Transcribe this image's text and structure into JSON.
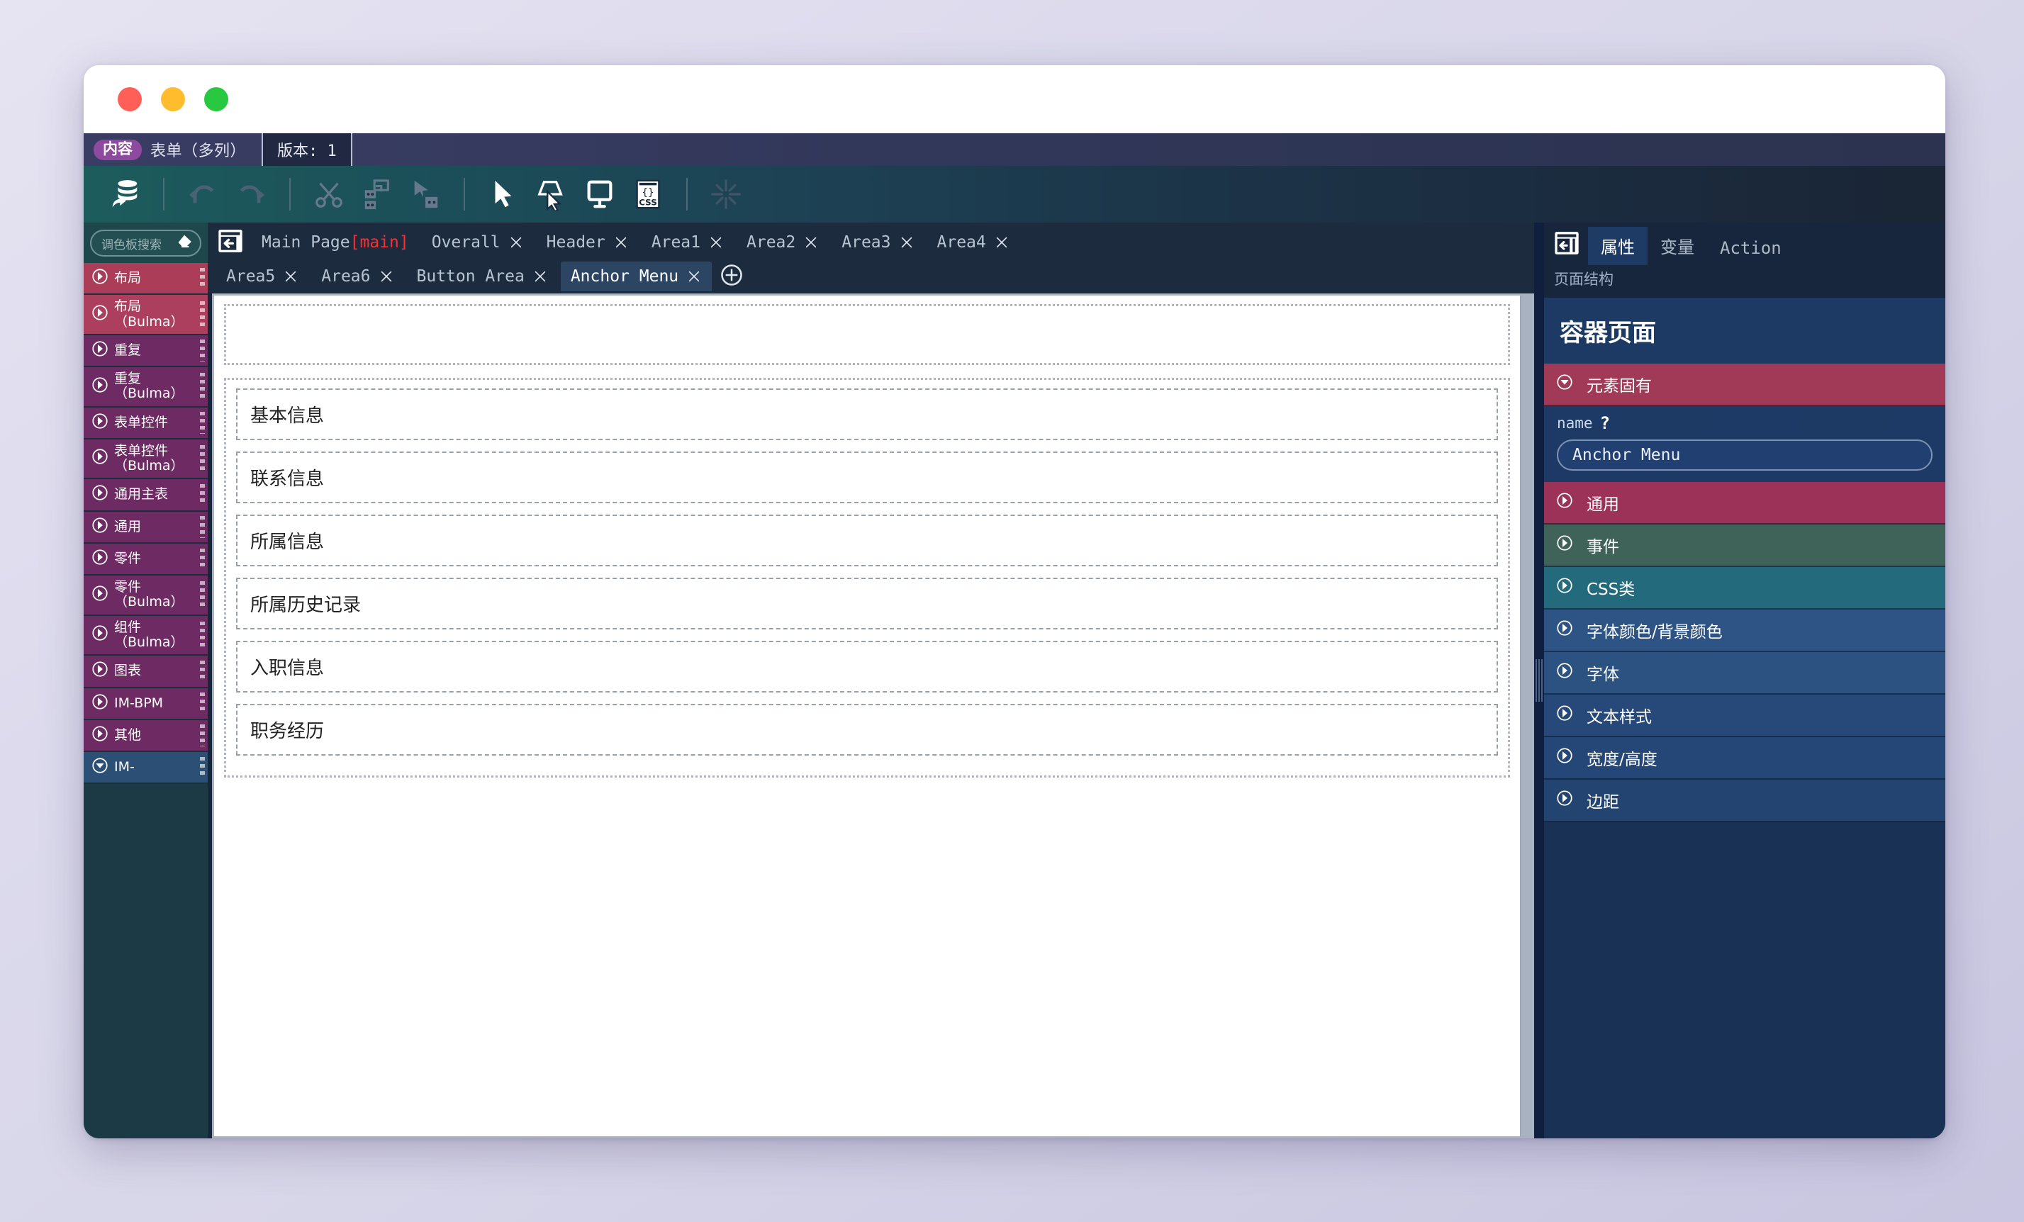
{
  "header": {
    "badge": "内容",
    "title": "表单（多列）",
    "version": "版本: 1"
  },
  "toolbar": {
    "items": [
      {
        "name": "save-to-database-button",
        "icon": "database-export-icon"
      },
      {
        "name": "undo-button",
        "icon": "undo-arrow-icon"
      },
      {
        "name": "redo-button",
        "icon": "redo-arrow-icon"
      },
      {
        "name": "cut-button",
        "icon": "scissors-icon"
      },
      {
        "name": "copy-button",
        "icon": "copy-blocks-icon"
      },
      {
        "name": "paste-button",
        "icon": "paste-arrow-icon"
      },
      {
        "name": "select-tool-button",
        "icon": "cursor-arrow-icon"
      },
      {
        "name": "pick-element-button",
        "icon": "cursor-select-shape-icon"
      },
      {
        "name": "preview-button",
        "icon": "monitor-icon"
      },
      {
        "name": "css-editor-button",
        "icon": "css-braces-icon"
      },
      {
        "name": "reset-layout-button",
        "icon": "asterisk-burst-icon"
      }
    ]
  },
  "palette": {
    "search_placeholder": "调色板搜索",
    "clear_icon": "eraser-icon",
    "items": [
      {
        "label": "布局",
        "color": "#ac3d58",
        "state": "collapsed"
      },
      {
        "label": "布局（Bulma）",
        "color": "#ab3f5d",
        "state": "collapsed"
      },
      {
        "label": "重复",
        "color": "#6e2a63",
        "state": "collapsed"
      },
      {
        "label": "重复（Bulma）",
        "color": "#6e2a63",
        "state": "collapsed"
      },
      {
        "label": "表单控件",
        "color": "#6e2a63",
        "state": "collapsed"
      },
      {
        "label": "表单控件\n（Bulma）",
        "color": "#6e2a63",
        "state": "collapsed"
      },
      {
        "label": "通用主表",
        "color": "#6e2a63",
        "state": "collapsed"
      },
      {
        "label": "通用",
        "color": "#6e2a63",
        "state": "collapsed"
      },
      {
        "label": "零件",
        "color": "#6e2a63",
        "state": "collapsed"
      },
      {
        "label": "零件（Bulma）",
        "color": "#6e2a63",
        "state": "collapsed"
      },
      {
        "label": "组件（Bulma）",
        "color": "#6e2a63",
        "state": "collapsed"
      },
      {
        "label": "图表",
        "color": "#6e2a63",
        "state": "collapsed"
      },
      {
        "label": "IM-BPM",
        "color": "#6e2a63",
        "state": "collapsed"
      },
      {
        "label": "其他",
        "color": "#6e2a63",
        "state": "collapsed"
      },
      {
        "label": "IM-",
        "color": "#2c4f75",
        "state": "expanded"
      }
    ]
  },
  "tabs": {
    "back_icon": "panel-collapse-left-icon",
    "add_icon": "add-tab-icon",
    "row1": [
      {
        "label": "Main Page",
        "suffix": "[main]",
        "closable": false,
        "active": false
      },
      {
        "label": "Overall",
        "closable": true,
        "active": false
      },
      {
        "label": "Header",
        "closable": true,
        "active": false
      },
      {
        "label": "Area1",
        "closable": true,
        "active": false
      },
      {
        "label": "Area2",
        "closable": true,
        "active": false
      },
      {
        "label": "Area3",
        "closable": true,
        "active": false
      },
      {
        "label": "Area4",
        "closable": true,
        "active": false
      }
    ],
    "row2": [
      {
        "label": "Area5",
        "closable": true,
        "active": false
      },
      {
        "label": "Area6",
        "closable": true,
        "active": false
      },
      {
        "label": "Button Area",
        "closable": true,
        "active": false
      },
      {
        "label": "Anchor Menu",
        "closable": true,
        "active": true
      }
    ]
  },
  "canvas": {
    "sections": [
      {
        "label": "基本信息"
      },
      {
        "label": "联系信息"
      },
      {
        "label": "所属信息"
      },
      {
        "label": "所属历史记录"
      },
      {
        "label": "入职信息"
      },
      {
        "label": "职务经历"
      }
    ]
  },
  "inspector": {
    "panel_icon": "panel-collapse-left-icon",
    "tabs": [
      {
        "label": "属性",
        "active": true
      },
      {
        "label": "变量",
        "active": false
      },
      {
        "label": "Action",
        "active": false,
        "mono": true
      }
    ],
    "subtabs": [
      {
        "label": "页面结构",
        "active": true
      }
    ],
    "title": "容器页面",
    "intrinsic_section": {
      "label": "元素固有",
      "color": "#a03a56",
      "state": "expanded"
    },
    "name_field": {
      "label": "name",
      "help": "?",
      "value": "Anchor Menu"
    },
    "sections": [
      {
        "label": "通用",
        "color": "#9c3257",
        "state": "collapsed"
      },
      {
        "label": "事件",
        "color": "#3f6358",
        "state": "collapsed"
      },
      {
        "label": "CSS类",
        "color": "#236a7c",
        "state": "collapsed"
      },
      {
        "label": "字体颜色/背景颜色",
        "color": "#2d5485",
        "state": "collapsed"
      },
      {
        "label": "字体",
        "color": "#2b5280",
        "state": "collapsed"
      },
      {
        "label": "文本样式",
        "color": "#27497a",
        "state": "collapsed"
      },
      {
        "label": "宽度/高度",
        "color": "#254777",
        "state": "collapsed"
      },
      {
        "label": "边距",
        "color": "#234471",
        "state": "collapsed"
      }
    ]
  }
}
